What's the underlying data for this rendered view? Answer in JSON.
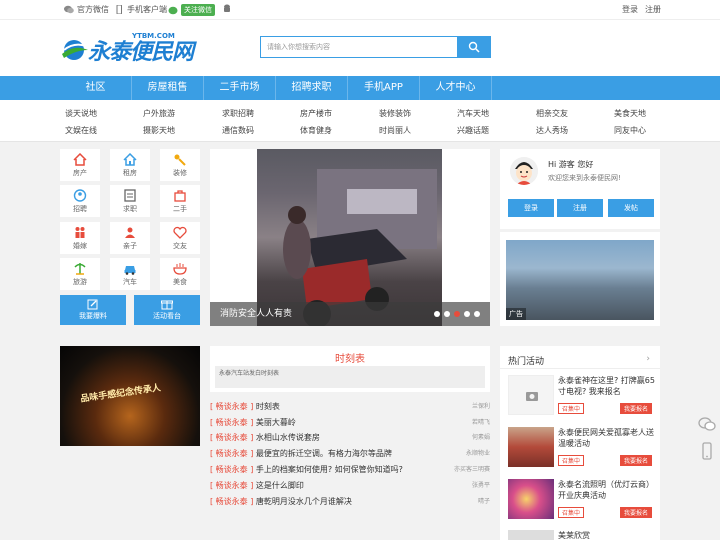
{
  "topbar": {
    "left": [
      "官方微信",
      "手机客户端",
      "关注微信"
    ],
    "right": [
      "登录",
      "注册"
    ]
  },
  "header": {
    "logo_text": "永泰便民网",
    "logo_url": "YTBM.COM",
    "search_placeholder": "请输入你想搜索内容"
  },
  "nav": [
    "社区",
    "房屋租售",
    "二手市场",
    "招聘求职",
    "手机APP",
    "人才中心"
  ],
  "subcats": [
    [
      "谈天说地",
      "户外旅游",
      "求职招聘",
      "房产楼市",
      "装修装饰",
      "汽车天地",
      "相亲交友",
      "美食天地"
    ],
    [
      "文娱在线",
      "摄影天地",
      "通信数码",
      "体育健身",
      "时尚丽人",
      "兴趣话题",
      "达人秀场",
      "同友中心"
    ]
  ],
  "categories": [
    {
      "label": "房产",
      "icon": "house-icon"
    },
    {
      "label": "租房",
      "icon": "rent-icon"
    },
    {
      "label": "装修",
      "icon": "decor-icon"
    },
    {
      "label": "招聘",
      "icon": "recruit-icon"
    },
    {
      "label": "求职",
      "icon": "jobseek-icon"
    },
    {
      "label": "二手",
      "icon": "secondhand-icon"
    },
    {
      "label": "婚嫁",
      "icon": "wedding-icon"
    },
    {
      "label": "亲子",
      "icon": "family-icon"
    },
    {
      "label": "交友",
      "icon": "friends-icon"
    },
    {
      "label": "旅游",
      "icon": "travel-icon"
    },
    {
      "label": "汽车",
      "icon": "car-icon"
    },
    {
      "label": "美食",
      "icon": "food-icon"
    }
  ],
  "action_buttons": [
    "我要爆料",
    "活动看台"
  ],
  "slider": {
    "caption": "消防安全人人有责",
    "dots": 5,
    "active_dot": 3
  },
  "user_panel": {
    "greeting": "Hi 游客 您好",
    "welcome": "欢迎您来到永泰便民网!",
    "buttons": [
      "登录",
      "注册",
      "发帖"
    ]
  },
  "side_image_tag": "广告",
  "night_photo_sign": "品味手感纪念传承人",
  "schedule": {
    "title": "时刻表",
    "subtitle": "永泰汽车站发白时刻表"
  },
  "news": [
    {
      "tag": "[ 畅谈永泰 ]",
      "title": "时刻表",
      "author": "兰保利"
    },
    {
      "tag": "[ 畅谈永泰 ]",
      "title": "美丽大暮岭",
      "author": "若晴飞"
    },
    {
      "tag": "[ 畅谈永泰 ]",
      "title": "水相山水传说套房",
      "author": "何素娟"
    },
    {
      "tag": "[ 畅谈永泰 ]",
      "title": "最便宜的拆迁空调。有格力海尔等品牌",
      "author": "永顺物业"
    },
    {
      "tag": "[ 畅谈永泰 ]",
      "title": "手上的档案如何使用? 如何保管你知道吗?",
      "author": "亦买客三明赛"
    },
    {
      "tag": "[ 畅谈永泰 ]",
      "title": "这是什么脚印",
      "author": "张勇平"
    },
    {
      "tag": "[ 畅谈永泰 ]",
      "title": "唐乾明月没水几个月谁解决",
      "author": "晴子"
    }
  ],
  "activities": {
    "heading": "热门活动",
    "items": [
      {
        "title": "永泰雀神在这里? 打牌赢65寸电视? 我来报名",
        "status": "召集中",
        "action": "我要报名"
      },
      {
        "title": "永泰便民网关爱孤寡老人送温暖活动",
        "status": "召集中",
        "action": "我要报名"
      },
      {
        "title": "永泰名流照明（优灯云商）开业庆典活动",
        "status": "召集中",
        "action": "我要报名"
      }
    ],
    "more": "美莱欣赏"
  },
  "colors": {
    "brand": "#3a9ee4",
    "accent": "#e74c3c",
    "green": "#3aaa35"
  }
}
